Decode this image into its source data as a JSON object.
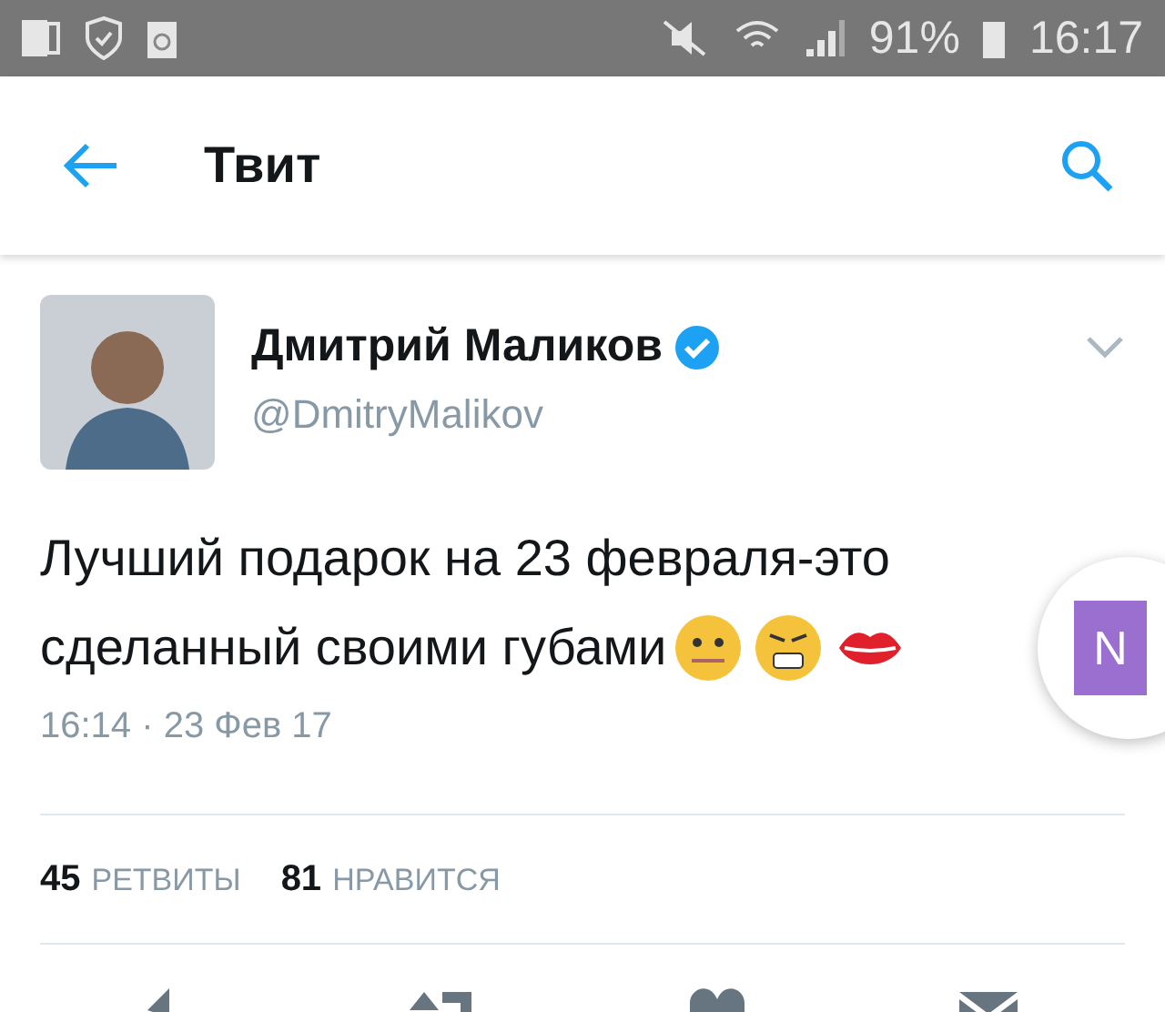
{
  "status_bar": {
    "battery": "91%",
    "time": "16:17"
  },
  "app_bar": {
    "title": "Твит"
  },
  "tweet": {
    "author": "Дмитрий Маликов",
    "verified": true,
    "handle": "@DmitryMalikov",
    "text_lines": [
      "Лучший подарок на 23 февраля-это",
      "сделанный своими губами"
    ],
    "timestamp": "16:14 · 23 Фев 17",
    "stats": [
      {
        "count": "45",
        "label": "РЕТВИТЫ"
      },
      {
        "count": "81",
        "label": "НРАВИТСЯ"
      }
    ]
  },
  "floating_bubble": {
    "label": "N"
  }
}
